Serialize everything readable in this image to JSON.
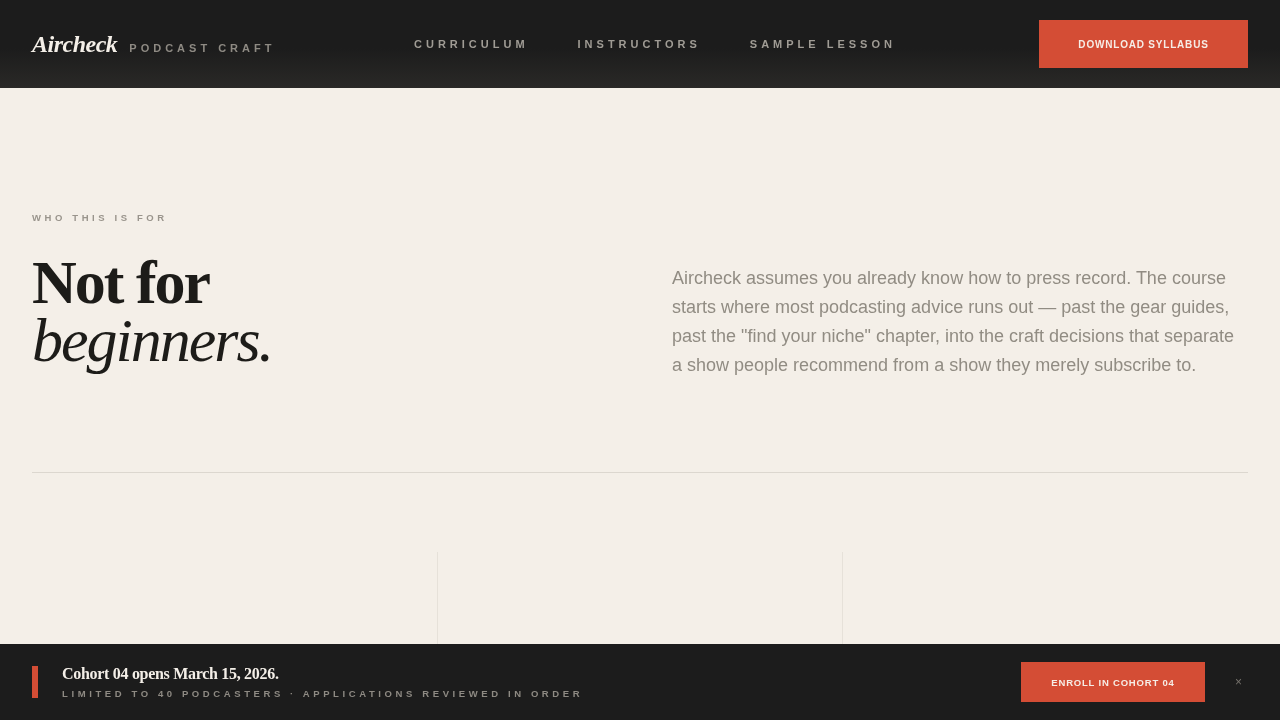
{
  "header": {
    "logo": "Aircheck",
    "tagline": "PODCAST CRAFT",
    "nav": [
      {
        "label": "CURRICULUM"
      },
      {
        "label": "INSTRUCTORS"
      },
      {
        "label": "SAMPLE LESSON"
      }
    ],
    "cta": "DOWNLOAD SYLLABUS"
  },
  "intro": {
    "eyebrow": "WHO THIS IS FOR",
    "headline_line_1": "Not for",
    "headline_line_2": "beginners.",
    "body": "Aircheck assumes you already know how to press record. The course starts where most podcasting advice runs out — past the gear guides, past the \"find your niche\" chapter, into the craft decisions that separate a show people recommend from a show they merely subscribe to."
  },
  "banner": {
    "title": "Cohort 04 opens March 15, 2026.",
    "subtitle": "LIMITED TO 40 PODCASTERS · APPLICATIONS REVIEWED IN ORDER",
    "button": "ENROLL IN COHORT 04",
    "close": "×"
  }
}
